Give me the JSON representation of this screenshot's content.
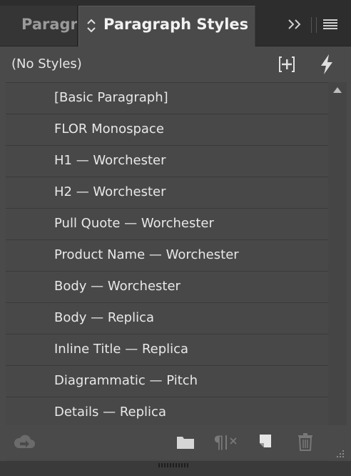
{
  "tabs": {
    "inactive_label": "Paragraph",
    "active_label": "Paragraph Styles"
  },
  "panel": {
    "current_style": "(No Styles)"
  },
  "styles": [
    "[Basic Paragraph]",
    "FLOR Monospace",
    "H1 — Worchester",
    "H2 — Worchester",
    "Pull Quote — Worchester",
    "Product Name — Worchester",
    "Body  — Worchester",
    "Body  — Replica",
    "Inline Title — Replica",
    "Diagrammatic  — Pitch",
    "Details  — Replica"
  ],
  "icons": {
    "tab_sort": "up-down-chevron-icon",
    "collapse": "double-chevron-right-icon",
    "menu": "hamburger-menu-icon",
    "add_group": "add-to-group-icon",
    "quick_apply": "lightning-icon",
    "cloud": "cloud-library-icon",
    "folder": "folder-icon",
    "clear_overrides": "clear-overrides-icon",
    "new_style": "new-style-icon",
    "delete": "trash-icon"
  },
  "colors": {
    "panel_bg": "#4a4a4a",
    "tab_bar_bg": "#2d2d2d",
    "text": "#e8e8e8",
    "divider": "#3a3a3a"
  }
}
